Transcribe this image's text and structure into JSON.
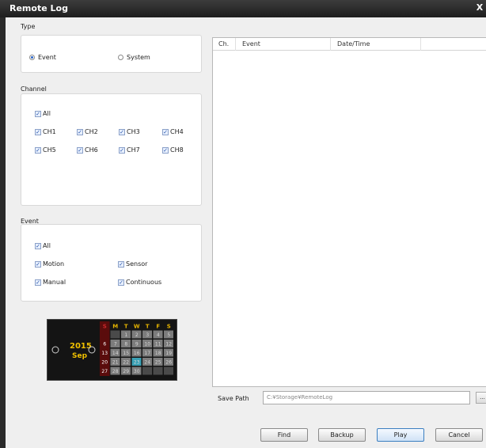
{
  "window": {
    "title": "Remote Log",
    "close_label": "X"
  },
  "type_group": {
    "label": "Type",
    "options": [
      {
        "label": "Event",
        "selected": true
      },
      {
        "label": "System",
        "selected": false
      }
    ]
  },
  "channel_group": {
    "label": "Channel",
    "all_label": "All",
    "channels": [
      "CH1",
      "CH2",
      "CH3",
      "CH4",
      "CH5",
      "CH6",
      "CH7",
      "CH8"
    ]
  },
  "event_group": {
    "label": "Event",
    "all_label": "All",
    "types": [
      "Motion",
      "Sensor",
      "Manual",
      "Continuous"
    ]
  },
  "calendar": {
    "year": "2015",
    "month": "Sep",
    "weekdays": [
      "S",
      "M",
      "T",
      "W",
      "T",
      "F",
      "S"
    ],
    "weeks": [
      [
        "",
        "",
        "1",
        "2",
        "3",
        "4",
        "5"
      ],
      [
        "6",
        "7",
        "8",
        "9",
        "10",
        "11",
        "12"
      ],
      [
        "13",
        "14",
        "15",
        "16",
        "17",
        "18",
        "19"
      ],
      [
        "20",
        "21",
        "22",
        "23",
        "24",
        "25",
        "26"
      ],
      [
        "27",
        "28",
        "29",
        "30",
        "",
        "",
        ""
      ]
    ],
    "highlighted_day": "23",
    "colors": {
      "sunday": "#c8282a",
      "weekday_header": "#e6b400",
      "year": "#f0c000",
      "highlight": "#3aa0b4"
    }
  },
  "results": {
    "columns": [
      "Ch.",
      "Event",
      "Date/Time"
    ],
    "rows": []
  },
  "save_path": {
    "label": "Save Path",
    "value": "C:¥Storage¥RemoteLog",
    "browse_label": "..."
  },
  "buttons": {
    "find": "Find",
    "backup": "Backup",
    "play": "Play",
    "cancel": "Cancel"
  }
}
